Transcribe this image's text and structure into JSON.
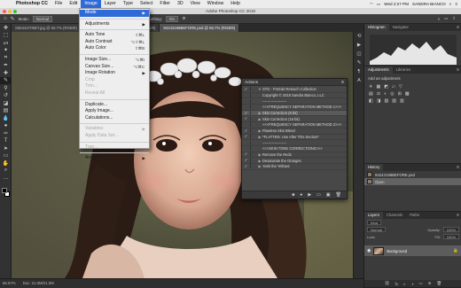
{
  "menubar": {
    "apple": "",
    "app": "Photoshop CC",
    "items": [
      "File",
      "Edit",
      "Image",
      "Layer",
      "Type",
      "Select",
      "Filter",
      "3D",
      "View",
      "Window",
      "Help"
    ],
    "active_index": 2,
    "clock": "Wed 2:27 PM",
    "user": "SANDRA BIANCO"
  },
  "titlebar": {
    "title": "Adobe Photoshop CC 2018"
  },
  "options": {
    "mode_label": "Mode:",
    "mode_value": "Normal",
    "flow_label": "Flow:",
    "flow_value": "100%",
    "smoothing_label": "Smoothing:",
    "smoothing_value": "0%"
  },
  "doc_tabs": [
    {
      "label": "S86443705BT.jpg @ 66.7% (RGB/8)",
      "active": false
    },
    {
      "label": "94243198BEFORE.jpg @ 66.7% (RGB/8)",
      "active": false
    },
    {
      "label": "94243198BEFORE.psd @ 66.7% (RGB/8)",
      "active": true
    }
  ],
  "image_menu": {
    "items": [
      {
        "label": "Mode",
        "arrow": "▶",
        "highlight": true
      },
      {
        "sep": true
      },
      {
        "label": "Adjustments",
        "arrow": "▶"
      },
      {
        "sep": true
      },
      {
        "label": "Auto Tone",
        "shortcut": "⇧⌘L"
      },
      {
        "label": "Auto Contrast",
        "shortcut": "⌥⇧⌘L"
      },
      {
        "label": "Auto Color",
        "shortcut": "⇧⌘B"
      },
      {
        "sep": true
      },
      {
        "label": "Image Size...",
        "shortcut": "⌥⌘I"
      },
      {
        "label": "Canvas Size...",
        "shortcut": "⌥⌘C"
      },
      {
        "label": "Image Rotation",
        "arrow": "▶"
      },
      {
        "label": "Crop",
        "dim": true
      },
      {
        "label": "Trim...",
        "dim": true
      },
      {
        "label": "Reveal All",
        "dim": true
      },
      {
        "sep": true
      },
      {
        "label": "Duplicate..."
      },
      {
        "label": "Apply Image..."
      },
      {
        "label": "Calculations..."
      },
      {
        "sep": true
      },
      {
        "label": "Variables",
        "arrow": "▶",
        "dim": true
      },
      {
        "label": "Apply Data Set...",
        "dim": true
      },
      {
        "sep": true
      },
      {
        "label": "Trap...",
        "dim": true
      },
      {
        "sep": true
      },
      {
        "label": "Analysis",
        "arrow": "▶"
      }
    ]
  },
  "actions_panel": {
    "title": "Actions",
    "menu_icon": "≡",
    "rows": [
      {
        "label": "STG - Portrait Retouch Collection",
        "check": "✓",
        "twisty": "▼",
        "sel": false
      },
      {
        "label": "Copyright © 2018 Sandra Bianco, LLC",
        "check": "",
        "twisty": "",
        "sel": false
      },
      {
        "label": "--------------------",
        "check": "",
        "twisty": "",
        "sel": false
      },
      {
        "label": "<<<FREQUENCY SEPARATION METHOD 1>>>",
        "check": "",
        "twisty": "",
        "sel": false
      },
      {
        "label": "Skin Correction (8 bit)",
        "check": "✓",
        "twisty": "▶",
        "sel": true
      },
      {
        "label": "Skin Correction (16 bit)",
        "check": "✓",
        "twisty": "▶",
        "sel": false
      },
      {
        "label": "<<<FREQUENCY SEPARATION METHOD 2>>>",
        "check": "",
        "twisty": "",
        "sel": false
      },
      {
        "label": "Flawless Skin Blend",
        "check": "✓",
        "twisty": "▶",
        "sel": false
      },
      {
        "label": "*FLATTEN: Use After This Section*",
        "check": "✓",
        "twisty": "▶",
        "sel": false
      },
      {
        "label": "--------------------",
        "check": "",
        "twisty": "",
        "sel": false
      },
      {
        "label": "<<<SKIN TONE CORRECTIONS>>>",
        "check": "",
        "twisty": "",
        "sel": false
      },
      {
        "label": "Remove the Reds",
        "check": "✓",
        "twisty": "▶",
        "sel": false
      },
      {
        "label": "Desaturate the Oranges",
        "check": "✓",
        "twisty": "▶",
        "sel": false
      },
      {
        "label": "Yank the Yellows",
        "check": "✓",
        "twisty": "▶",
        "sel": false
      }
    ],
    "footer_icons": [
      "■",
      "●",
      "▶",
      "▭",
      "▣",
      "🗑"
    ]
  },
  "right_panels": {
    "histogram_tabs": [
      "Histogram",
      "Navigator"
    ],
    "adjust_tabs": [
      "Adjustments",
      "Libraries"
    ],
    "adjust_title": "Add an adjustment",
    "adjust_icons_row1": [
      "☀",
      "▦",
      "◩",
      "▱",
      "▽"
    ],
    "adjust_icons_row2": [
      "▤",
      "⚖",
      "◐",
      "◎",
      "⊞",
      "▩"
    ],
    "adjust_icons_row3": [
      "◧",
      "◨",
      "▧",
      "▨",
      "▥"
    ],
    "history_tabs": [
      "History"
    ],
    "history_rows": [
      {
        "label": "94243198BEFORE.psd",
        "sel": false
      },
      {
        "label": "Open",
        "sel": true
      }
    ],
    "layers_tabs": [
      "Layers",
      "Channels",
      "Paths"
    ],
    "layers_kind": "Kind",
    "layers_blend": "Normal",
    "layers_opacity_label": "Opacity:",
    "layers_opacity": "100%",
    "layers_lock_label": "Lock:",
    "layers_fill_label": "Fill:",
    "layers_fill": "100%",
    "layer_rows": [
      {
        "label": "Background",
        "lock": "🔒"
      }
    ],
    "layers_footer_icons": [
      "⛓",
      "fx",
      "◐",
      "◑",
      "▭",
      "⊕",
      "🗑"
    ]
  },
  "status": {
    "zoom": "66.67%",
    "doc": "Doc: 21.0M/21.0M"
  }
}
